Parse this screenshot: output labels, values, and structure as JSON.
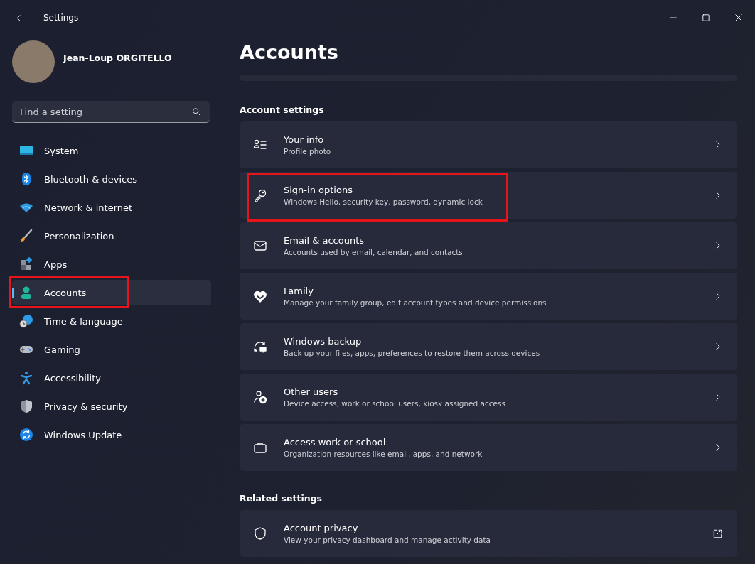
{
  "window": {
    "title": "Settings"
  },
  "profile": {
    "name": "Jean-Loup ORGITELLO"
  },
  "search": {
    "placeholder": "Find a setting"
  },
  "sidebar": {
    "items": [
      {
        "label": "System",
        "selected": false,
        "annotated": false
      },
      {
        "label": "Bluetooth & devices",
        "selected": false,
        "annotated": false
      },
      {
        "label": "Network & internet",
        "selected": false,
        "annotated": false
      },
      {
        "label": "Personalization",
        "selected": false,
        "annotated": false
      },
      {
        "label": "Apps",
        "selected": false,
        "annotated": false
      },
      {
        "label": "Accounts",
        "selected": true,
        "annotated": true
      },
      {
        "label": "Time & language",
        "selected": false,
        "annotated": false
      },
      {
        "label": "Gaming",
        "selected": false,
        "annotated": false
      },
      {
        "label": "Accessibility",
        "selected": false,
        "annotated": false
      },
      {
        "label": "Privacy & security",
        "selected": false,
        "annotated": false
      },
      {
        "label": "Windows Update",
        "selected": false,
        "annotated": false
      }
    ]
  },
  "page": {
    "title": "Accounts",
    "sections": [
      {
        "heading": "Account settings",
        "items": [
          {
            "title": "Your info",
            "subtitle": "Profile photo",
            "annotated": false,
            "kind": "chevron"
          },
          {
            "title": "Sign-in options",
            "subtitle": "Windows Hello, security key, password, dynamic lock",
            "annotated": true,
            "kind": "chevron"
          },
          {
            "title": "Email & accounts",
            "subtitle": "Accounts used by email, calendar, and contacts",
            "annotated": false,
            "kind": "chevron"
          },
          {
            "title": "Family",
            "subtitle": "Manage your family group, edit account types and device permissions",
            "annotated": false,
            "kind": "chevron"
          },
          {
            "title": "Windows backup",
            "subtitle": "Back up your files, apps, preferences to restore them across devices",
            "annotated": false,
            "kind": "chevron"
          },
          {
            "title": "Other users",
            "subtitle": "Device access, work or school users, kiosk assigned access",
            "annotated": false,
            "kind": "chevron"
          },
          {
            "title": "Access work or school",
            "subtitle": "Organization resources like email, apps, and network",
            "annotated": false,
            "kind": "chevron"
          }
        ]
      },
      {
        "heading": "Related settings",
        "items": [
          {
            "title": "Account privacy",
            "subtitle": "View your privacy dashboard and manage activity data",
            "annotated": false,
            "kind": "external"
          }
        ]
      }
    ]
  }
}
